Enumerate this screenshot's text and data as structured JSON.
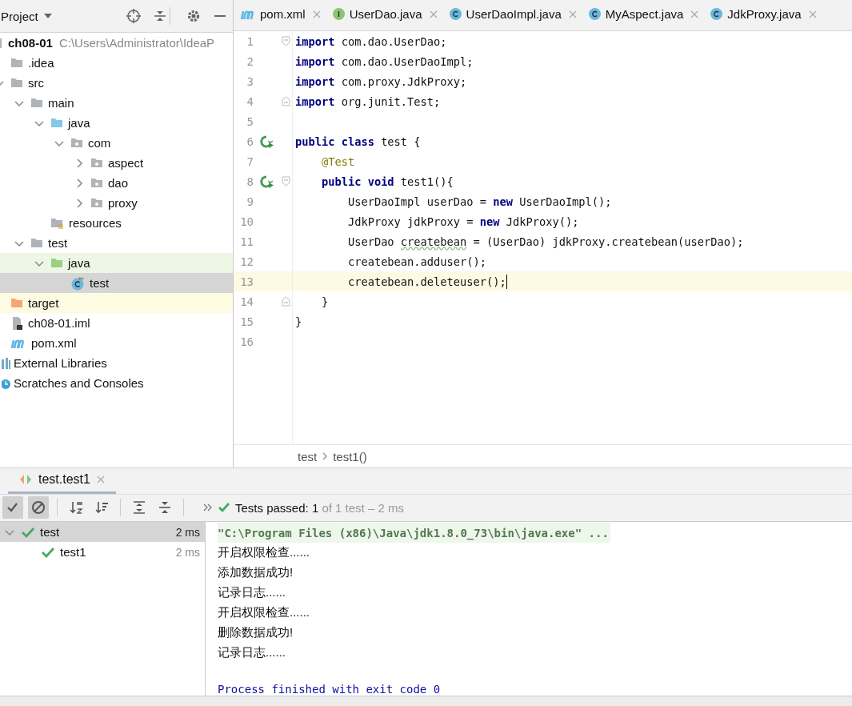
{
  "project_panel": {
    "title": "Project",
    "tree": [
      {
        "label": "ch08-01",
        "path": "C:\\Users\\Administrator\\IdeaP",
        "kind": "module",
        "selected": false,
        "children": [
          {
            "label": ".idea",
            "kind": "folder",
            "selected": false
          },
          {
            "label": "src",
            "kind": "folder",
            "expanded": true,
            "selected": false,
            "children": [
              {
                "label": "main",
                "kind": "folder",
                "expanded": true,
                "selected": false,
                "children": [
                  {
                    "label": "java",
                    "kind": "source-folder",
                    "expanded": true,
                    "selected": false,
                    "children": [
                      {
                        "label": "com",
                        "kind": "package",
                        "expanded": true,
                        "selected": false,
                        "children": [
                          {
                            "label": "aspect",
                            "kind": "package",
                            "expanded": false,
                            "selected": false
                          },
                          {
                            "label": "dao",
                            "kind": "package",
                            "expanded": false,
                            "selected": false
                          },
                          {
                            "label": "proxy",
                            "kind": "package",
                            "expanded": false,
                            "selected": false
                          }
                        ]
                      }
                    ]
                  },
                  {
                    "label": "resources",
                    "kind": "resources",
                    "selected": false
                  }
                ]
              },
              {
                "label": "test",
                "kind": "folder",
                "expanded": true,
                "selected": false,
                "children": [
                  {
                    "label": "java",
                    "kind": "test-folder",
                    "expanded": true,
                    "selected": false,
                    "children": [
                      {
                        "label": "test",
                        "kind": "test-class",
                        "selected": true
                      }
                    ]
                  }
                ]
              }
            ]
          },
          {
            "label": "target",
            "kind": "excluded",
            "selected": false
          },
          {
            "label": "ch08-01.iml",
            "kind": "iml",
            "selected": false
          },
          {
            "label": "pom.xml",
            "kind": "maven",
            "selected": false
          }
        ]
      },
      {
        "label": "External Libraries",
        "kind": "libraries",
        "selected": false
      },
      {
        "label": "Scratches and Consoles",
        "kind": "scratches",
        "selected": false
      }
    ]
  },
  "editor": {
    "tabs": [
      {
        "label": "pom.xml",
        "kind": "maven",
        "selected": false
      },
      {
        "label": "UserDao.java",
        "kind": "interface",
        "selected": false
      },
      {
        "label": "UserDaoImpl.java",
        "kind": "class",
        "selected": false
      },
      {
        "label": "MyAspect.java",
        "kind": "class",
        "selected": false
      },
      {
        "label": "JdkProxy.java",
        "kind": "class",
        "selected": false
      }
    ],
    "lines": [
      {
        "number": "1",
        "fold_start": true,
        "tokens": [
          {
            "text": "import",
            "kind": "keyword"
          },
          {
            "text": " com.dao.UserDao;",
            "kind": "plain"
          }
        ]
      },
      {
        "number": "2",
        "tokens": [
          {
            "text": "import",
            "kind": "keyword"
          },
          {
            "text": " com.dao.UserDaoImpl;",
            "kind": "plain"
          }
        ]
      },
      {
        "number": "3",
        "tokens": [
          {
            "text": "import",
            "kind": "keyword"
          },
          {
            "text": " com.proxy.JdkProxy;",
            "kind": "plain"
          }
        ]
      },
      {
        "number": "4",
        "fold_end": true,
        "tokens": [
          {
            "text": "import",
            "kind": "keyword"
          },
          {
            "text": " org.junit.Test;",
            "kind": "plain"
          }
        ]
      },
      {
        "number": "5"
      },
      {
        "number": "6",
        "run": true,
        "tokens": [
          {
            "text": "public class",
            "kind": "keyword"
          },
          {
            "text": " test {",
            "kind": "plain"
          }
        ]
      },
      {
        "number": "7",
        "tokens": [
          {
            "text": "    @Test",
            "kind": "annotation"
          }
        ]
      },
      {
        "number": "8",
        "run": true,
        "fold_start": true,
        "tokens": [
          {
            "text": "    public void",
            "kind": "keyword"
          },
          {
            "text": " test1(){",
            "kind": "plain"
          }
        ]
      },
      {
        "number": "9",
        "tokens": [
          {
            "text": "        UserDaoImpl userDao = ",
            "kind": "plain"
          },
          {
            "text": "new",
            "kind": "keyword"
          },
          {
            "text": " UserDaoImpl();",
            "kind": "plain"
          }
        ]
      },
      {
        "number": "10",
        "tokens": [
          {
            "text": "        JdkProxy jdkProxy = ",
            "kind": "plain"
          },
          {
            "text": "new",
            "kind": "keyword"
          },
          {
            "text": " JdkProxy();",
            "kind": "plain"
          }
        ]
      },
      {
        "number": "11",
        "tokens": [
          {
            "text": "        UserDao ",
            "kind": "plain"
          },
          {
            "text": "createbean",
            "kind": "warning"
          },
          {
            "text": " = (UserDao) jdkProxy.createbean(userDao);",
            "kind": "plain"
          }
        ]
      },
      {
        "number": "12",
        "tokens": [
          {
            "text": "        createbean.adduser();",
            "kind": "plain"
          }
        ]
      },
      {
        "number": "13",
        "current": true,
        "tokens": [
          {
            "text": "        createbean.deleteuser();",
            "kind": "plain"
          }
        ]
      },
      {
        "number": "14",
        "fold_end": true,
        "tokens": [
          {
            "text": "    }",
            "kind": "plain"
          }
        ]
      },
      {
        "number": "15",
        "tokens": [
          {
            "text": "}",
            "kind": "plain"
          }
        ]
      },
      {
        "number": "16"
      }
    ],
    "breadcrumbs": [
      "test",
      "test1()"
    ]
  },
  "run_panel": {
    "tab": "test.test1",
    "toolbar": [
      {
        "kind": "show-passed",
        "pressed": true
      },
      {
        "kind": "show-ignored",
        "pressed": true
      },
      {
        "kind": "sort-alpha",
        "pressed": false
      },
      {
        "kind": "sort-duration",
        "pressed": false
      },
      {
        "kind": "expand-all",
        "pressed": false
      },
      {
        "kind": "collapse-all",
        "pressed": false
      }
    ],
    "status": {
      "passed": "Tests passed: 1",
      "detail": " of 1 test – 2 ms"
    },
    "tests": [
      {
        "label": "test",
        "time": "2 ms",
        "expanded": true,
        "selected": true,
        "children": [
          {
            "label": "test1",
            "time": "2 ms",
            "selected": false
          }
        ]
      }
    ],
    "console": [
      {
        "text": "\"C:\\Program Files (x86)\\Java\\jdk1.8.0_73\\bin\\java.exe\" ...",
        "kind": "command"
      },
      {
        "text": "开启权限检查......",
        "kind": "output"
      },
      {
        "text": "添加数据成功!",
        "kind": "output"
      },
      {
        "text": "记录日志......",
        "kind": "output"
      },
      {
        "text": "开启权限检查......",
        "kind": "output"
      },
      {
        "text": "删除数据成功!",
        "kind": "output"
      },
      {
        "text": "记录日志......",
        "kind": "output"
      },
      {
        "text": "Process finished with exit code 0",
        "kind": "system"
      }
    ]
  }
}
